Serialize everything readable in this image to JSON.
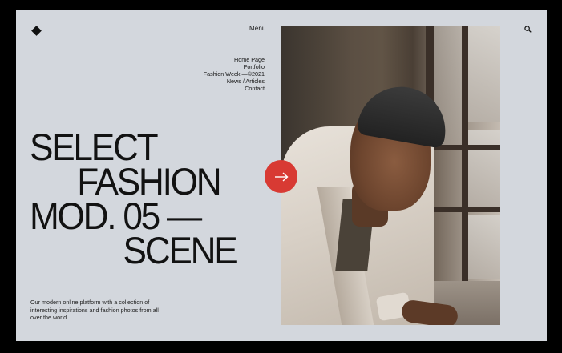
{
  "header": {
    "menu_label": "Menu",
    "logo_icon": "diamond-logo-icon",
    "search_icon": "search-icon"
  },
  "nav": {
    "items": [
      {
        "label": "Home Page"
      },
      {
        "label": "Portfolio"
      },
      {
        "label": "Fashion Week —©2021"
      },
      {
        "label": "News / Articles"
      },
      {
        "label": "Contact"
      }
    ]
  },
  "hero": {
    "headline": [
      "SELECT",
      "FASHION",
      "MOD. 05 —",
      "SCENE"
    ],
    "description": "Our modern online platform with a collection of interesting inspirations and fashion photos from all over the world.",
    "arrow_icon": "arrow-right-icon"
  },
  "colors": {
    "background": "#d3d7dd",
    "accent": "#d83a33",
    "text": "#121212"
  }
}
